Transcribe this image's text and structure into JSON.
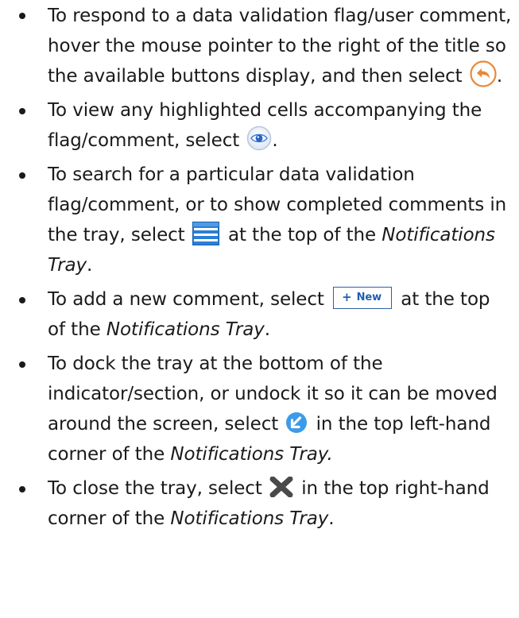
{
  "items": [
    {
      "text_before": "To respond to a data validation flag/user comment, hover the mouse pointer to the right of the title so the available buttons display, and then select",
      "text_after": "."
    },
    {
      "text_before": "To view any highlighted cells accompanying the flag/comment, select",
      "text_after": "."
    },
    {
      "text_before": "To search for a particular data validation flag/comment, or to show completed comments in the tray, select",
      "text_mid": " at the top of the ",
      "emphasis": "Notifications Tray",
      "text_after": "."
    },
    {
      "text_before": "To add a new comment, select",
      "text_mid": " at the top of the ",
      "emphasis": "Notifications Tray",
      "text_after": "."
    },
    {
      "text_before": "To dock the tray at the bottom of the indicator/section, or undock it so it can be moved around the screen, select",
      "text_mid": " in the top left-hand corner of the ",
      "emphasis": "Notifications Tray.",
      "text_after": ""
    },
    {
      "text_before": "To close the tray, select",
      "text_mid": " in the top right-hand corner of the ",
      "emphasis": "Notifications Tray",
      "text_after": "."
    }
  ],
  "buttons": {
    "new_label": "New",
    "new_plus": "+"
  },
  "icons": {
    "reply": "reply-arrow-icon",
    "eye": "eye-icon",
    "menu": "hamburger-menu-icon",
    "dock": "dock-arrow-icon",
    "close": "close-x-icon"
  },
  "colors": {
    "text": "#1a1a1a",
    "reply_orange": "#e8893a",
    "eye_blue": "#3b7dd8",
    "menu_blue": "#2a7fd6",
    "dock_blue": "#3b9be8",
    "close_gray": "#4a4a4a",
    "new_button_blue": "#1f5fae"
  }
}
